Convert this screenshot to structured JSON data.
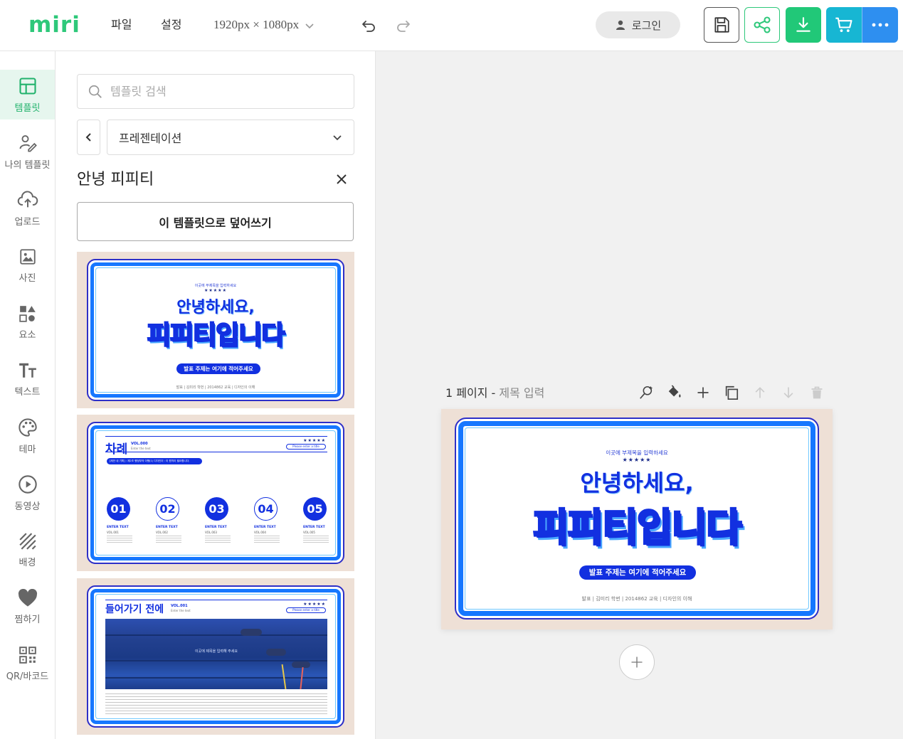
{
  "header": {
    "logo": "miri",
    "menu_file": "파일",
    "menu_settings": "설정",
    "canvas_size": "1920px × 1080px",
    "login_label": "로그인",
    "icons": [
      "undo-icon",
      "redo-icon",
      "save-icon",
      "share-icon",
      "download-icon",
      "cart-icon",
      "more-icon"
    ],
    "colors": {
      "brand": "#2ec87a",
      "download": "#21c878",
      "cart": "#17b6d3",
      "more": "#2e8ff0"
    }
  },
  "rail": {
    "items": [
      {
        "label": "템플릿",
        "icon": "layout-icon",
        "active": true
      },
      {
        "label": "나의 템플릿",
        "icon": "user-edit-icon"
      },
      {
        "label": "업로드",
        "icon": "cloud-upload-icon"
      },
      {
        "label": "사진",
        "icon": "image-icon"
      },
      {
        "label": "요소",
        "icon": "shapes-icon"
      },
      {
        "label": "텍스트",
        "icon": "text-icon"
      },
      {
        "label": "테마",
        "icon": "palette-icon"
      },
      {
        "label": "동영상",
        "icon": "play-icon"
      },
      {
        "label": "배경",
        "icon": "stripes-icon"
      },
      {
        "label": "찜하기",
        "icon": "heart-icon"
      },
      {
        "label": "QR/바코드",
        "icon": "qr-icon"
      }
    ]
  },
  "panel": {
    "search_placeholder": "템플릿 검색",
    "category": "프레젠테이션",
    "title": "안녕 피피티",
    "overwrite_label": "이 템플릿으로 덮어쓰기",
    "thumbnails": {
      "t1": {
        "small": "이곳에 부제목을 입력하세요",
        "stars": "★★★★★",
        "hello": "안녕하세요,",
        "big": "피피티입니다",
        "pill": "발표 주제는 여기에 적어주세요",
        "meta": "발표 | 김미리   학번 | 2014862   교육 | 디자인의 이해"
      },
      "t2": {
        "title": "차례",
        "vol": "VOL.000",
        "sub": "Enter the text",
        "stars": "★★★★★",
        "pill_right": "Please enter a title",
        "bar": "[제안 내 기획] : 제2조 행정부의 이행(1) 디자인이 : 이 원칙이 필요합니다.",
        "items": [
          {
            "num": "01",
            "label": "ENTER TEXT",
            "vol": "VOL.001"
          },
          {
            "num": "02",
            "label": "ENTER TEXT",
            "vol": "VOL.002"
          },
          {
            "num": "03",
            "label": "ENTER TEXT",
            "vol": "VOL.003"
          },
          {
            "num": "04",
            "label": "ENTER TEXT",
            "vol": "VOL.004"
          },
          {
            "num": "05",
            "label": "ENTER TEXT",
            "vol": "VOL.005"
          }
        ]
      },
      "t3": {
        "title": "들어가기 전에",
        "vol": "VOL.001",
        "sub": "Enter the text",
        "stars": "★★★★★",
        "pill_right": "Please enter a title",
        "photo_caption": "이곳에 제목을 입력해 주세요"
      }
    }
  },
  "canvas": {
    "page_number": "1 페이지",
    "separator": " - ",
    "page_title_placeholder": "제목 입력",
    "tool_icons": [
      "magic-pick-icon",
      "paint-bucket-icon",
      "add-icon",
      "duplicate-icon",
      "move-up-icon",
      "move-down-icon",
      "trash-icon"
    ],
    "slide": {
      "small": "이곳에 부제목을 입력하세요",
      "stars": "★★★★★",
      "hello": "안녕하세요,",
      "big": "피피티입니다",
      "pill": "발표 주제는 여기에 적어주세요",
      "meta": "발표 | 김미리   학번 | 2014862   교육 | 디자인의 이해"
    }
  }
}
